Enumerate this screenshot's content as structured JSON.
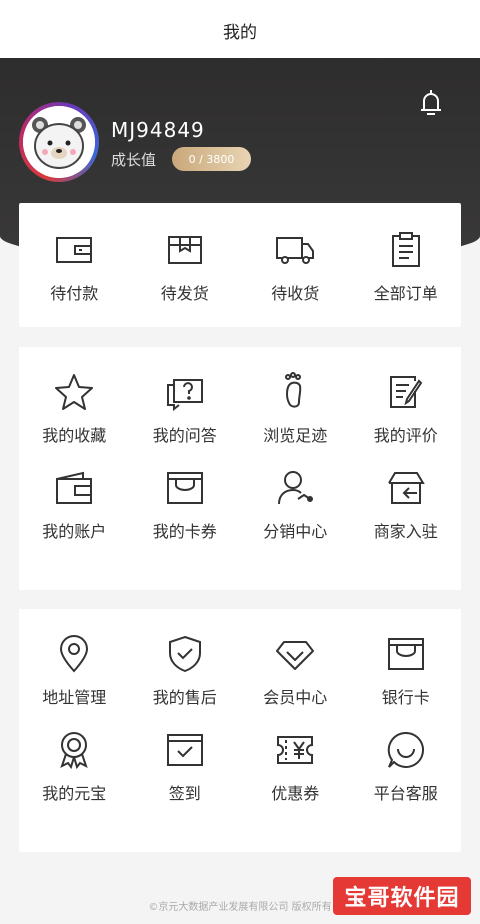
{
  "header": {
    "title": "我的"
  },
  "profile": {
    "username": "MJ94849",
    "growth_label": "成长值",
    "growth_value": "0 / 3800"
  },
  "icons": {
    "bell": "bell-icon"
  },
  "orders": [
    {
      "label": "待付款",
      "icon": "wallet-icon"
    },
    {
      "label": "待发货",
      "icon": "box-icon"
    },
    {
      "label": "待收货",
      "icon": "truck-icon"
    },
    {
      "label": "全部订单",
      "icon": "clipboard-icon"
    }
  ],
  "section_a": [
    {
      "label": "我的收藏",
      "icon": "star-icon"
    },
    {
      "label": "我的问答",
      "icon": "question-chat-icon"
    },
    {
      "label": "浏览足迹",
      "icon": "footprint-icon"
    },
    {
      "label": "我的评价",
      "icon": "edit-note-icon"
    },
    {
      "label": "我的账户",
      "icon": "account-wallet-icon"
    },
    {
      "label": "我的卡券",
      "icon": "coupon-box-icon"
    },
    {
      "label": "分销中心",
      "icon": "distribution-icon"
    },
    {
      "label": "商家入驻",
      "icon": "store-enter-icon"
    }
  ],
  "section_b": [
    {
      "label": "地址管理",
      "icon": "location-icon"
    },
    {
      "label": "我的售后",
      "icon": "shield-check-icon"
    },
    {
      "label": "会员中心",
      "icon": "diamond-icon"
    },
    {
      "label": "银行卡",
      "icon": "bank-card-icon"
    },
    {
      "label": "我的元宝",
      "icon": "medal-icon"
    },
    {
      "label": "签到",
      "icon": "checkin-icon"
    },
    {
      "label": "优惠券",
      "icon": "yen-ticket-icon"
    },
    {
      "label": "平台客服",
      "icon": "service-smile-icon"
    }
  ],
  "footer": {
    "text": "©京元大数据产业发展有限公司 版权所有"
  },
  "watermark": {
    "text": "宝哥软件园"
  }
}
